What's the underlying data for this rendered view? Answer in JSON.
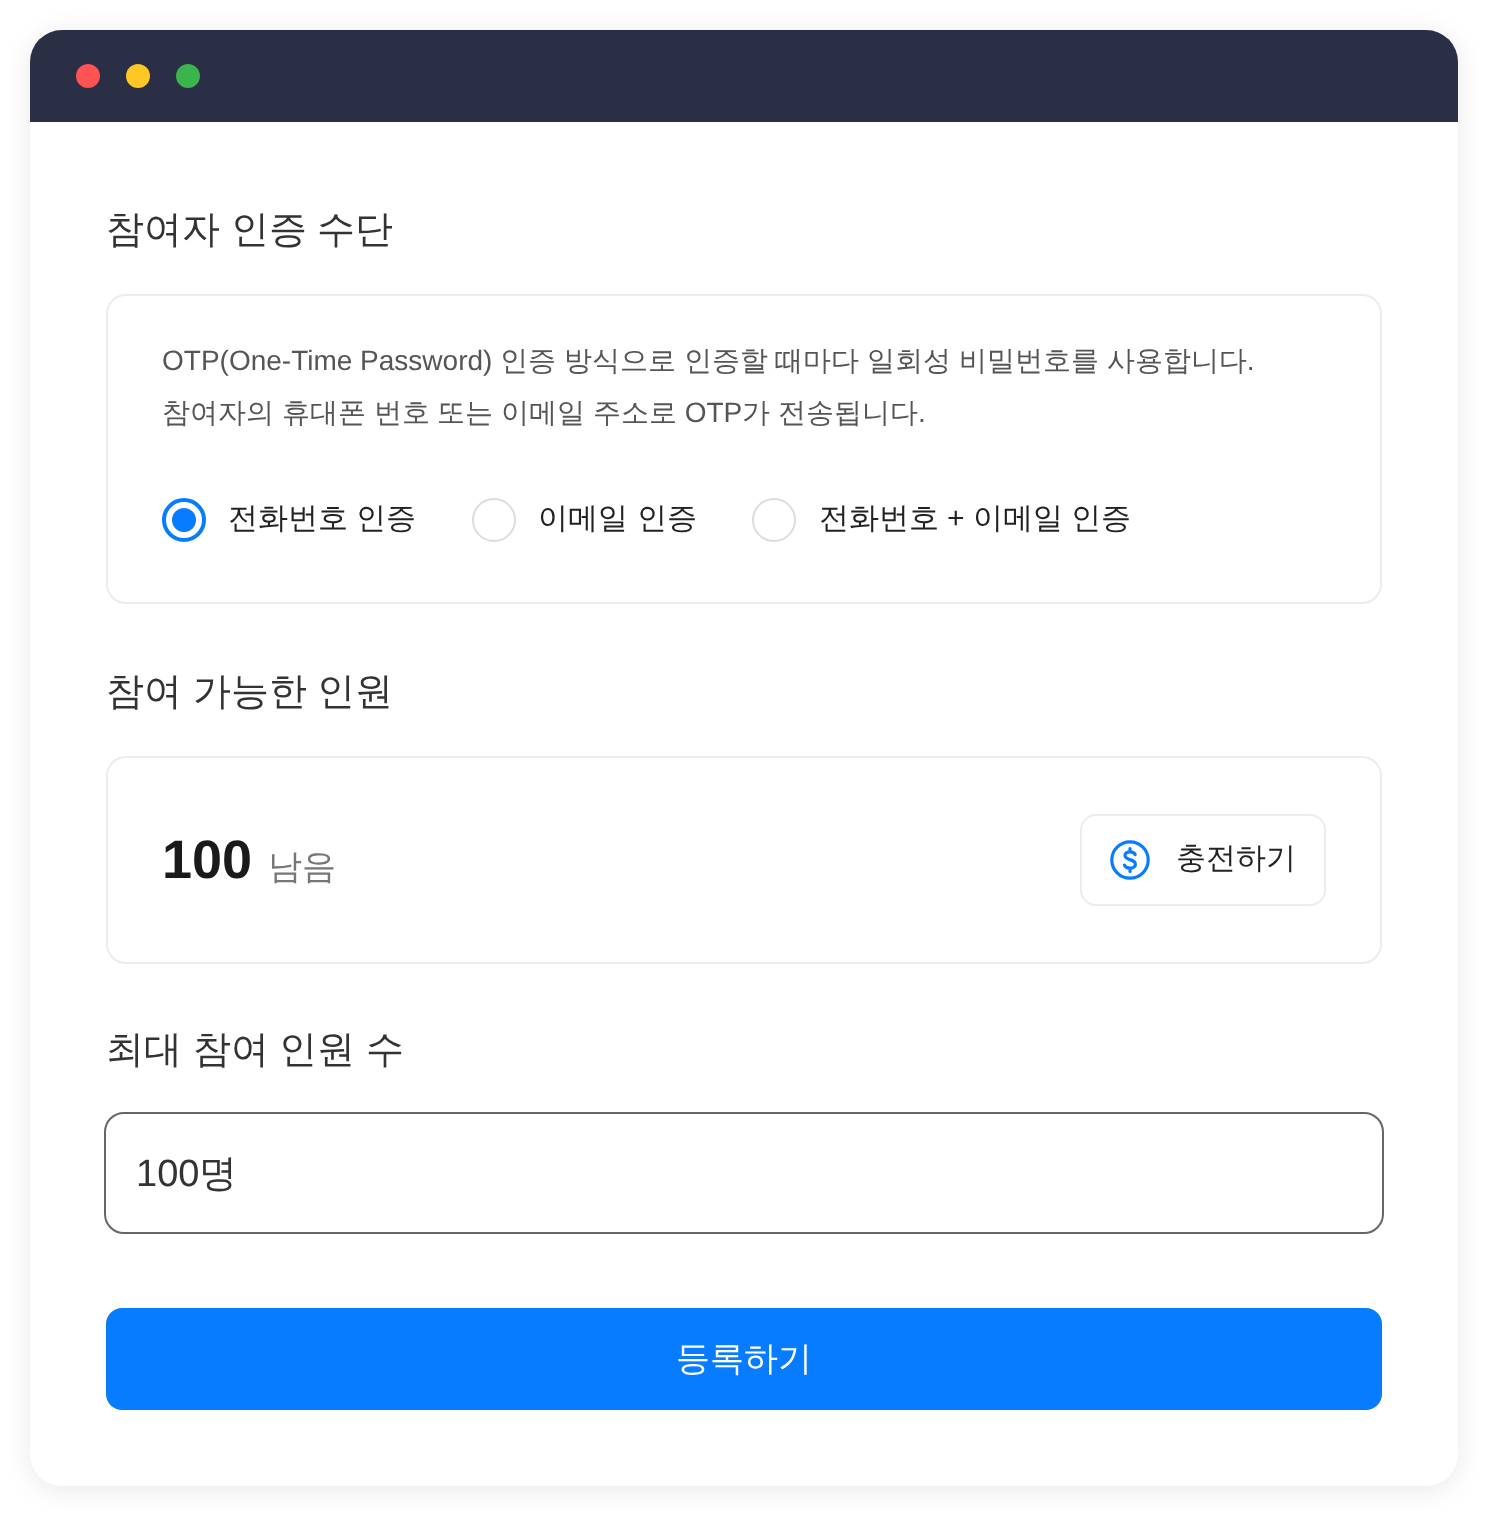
{
  "window": {
    "controls": [
      {
        "color": "#ff5252"
      },
      {
        "color": "#fdc823"
      },
      {
        "color": "#3bb44b"
      }
    ]
  },
  "auth_method": {
    "title": "참여자 인증 수단",
    "description": [
      "OTP(One-Time Password) 인증 방식으로 인증할 때마다 일회성 비밀번호를 사용합니다.",
      "참여자의 휴대폰 번호 또는 이메일 주소로 OTP가 전송됩니다."
    ],
    "options": [
      {
        "label": "전화번호 인증",
        "selected": true
      },
      {
        "label": "이메일 인증",
        "selected": false
      },
      {
        "label": "전화번호 + 이메일 인증",
        "selected": false
      }
    ]
  },
  "available": {
    "title": "참여 가능한 인원",
    "count": "100",
    "unit": "남음",
    "charge_button": "충전하기"
  },
  "max_participants": {
    "title": "최대 참여 인원 수",
    "value": "100명"
  },
  "submit_button": "등록하기"
}
